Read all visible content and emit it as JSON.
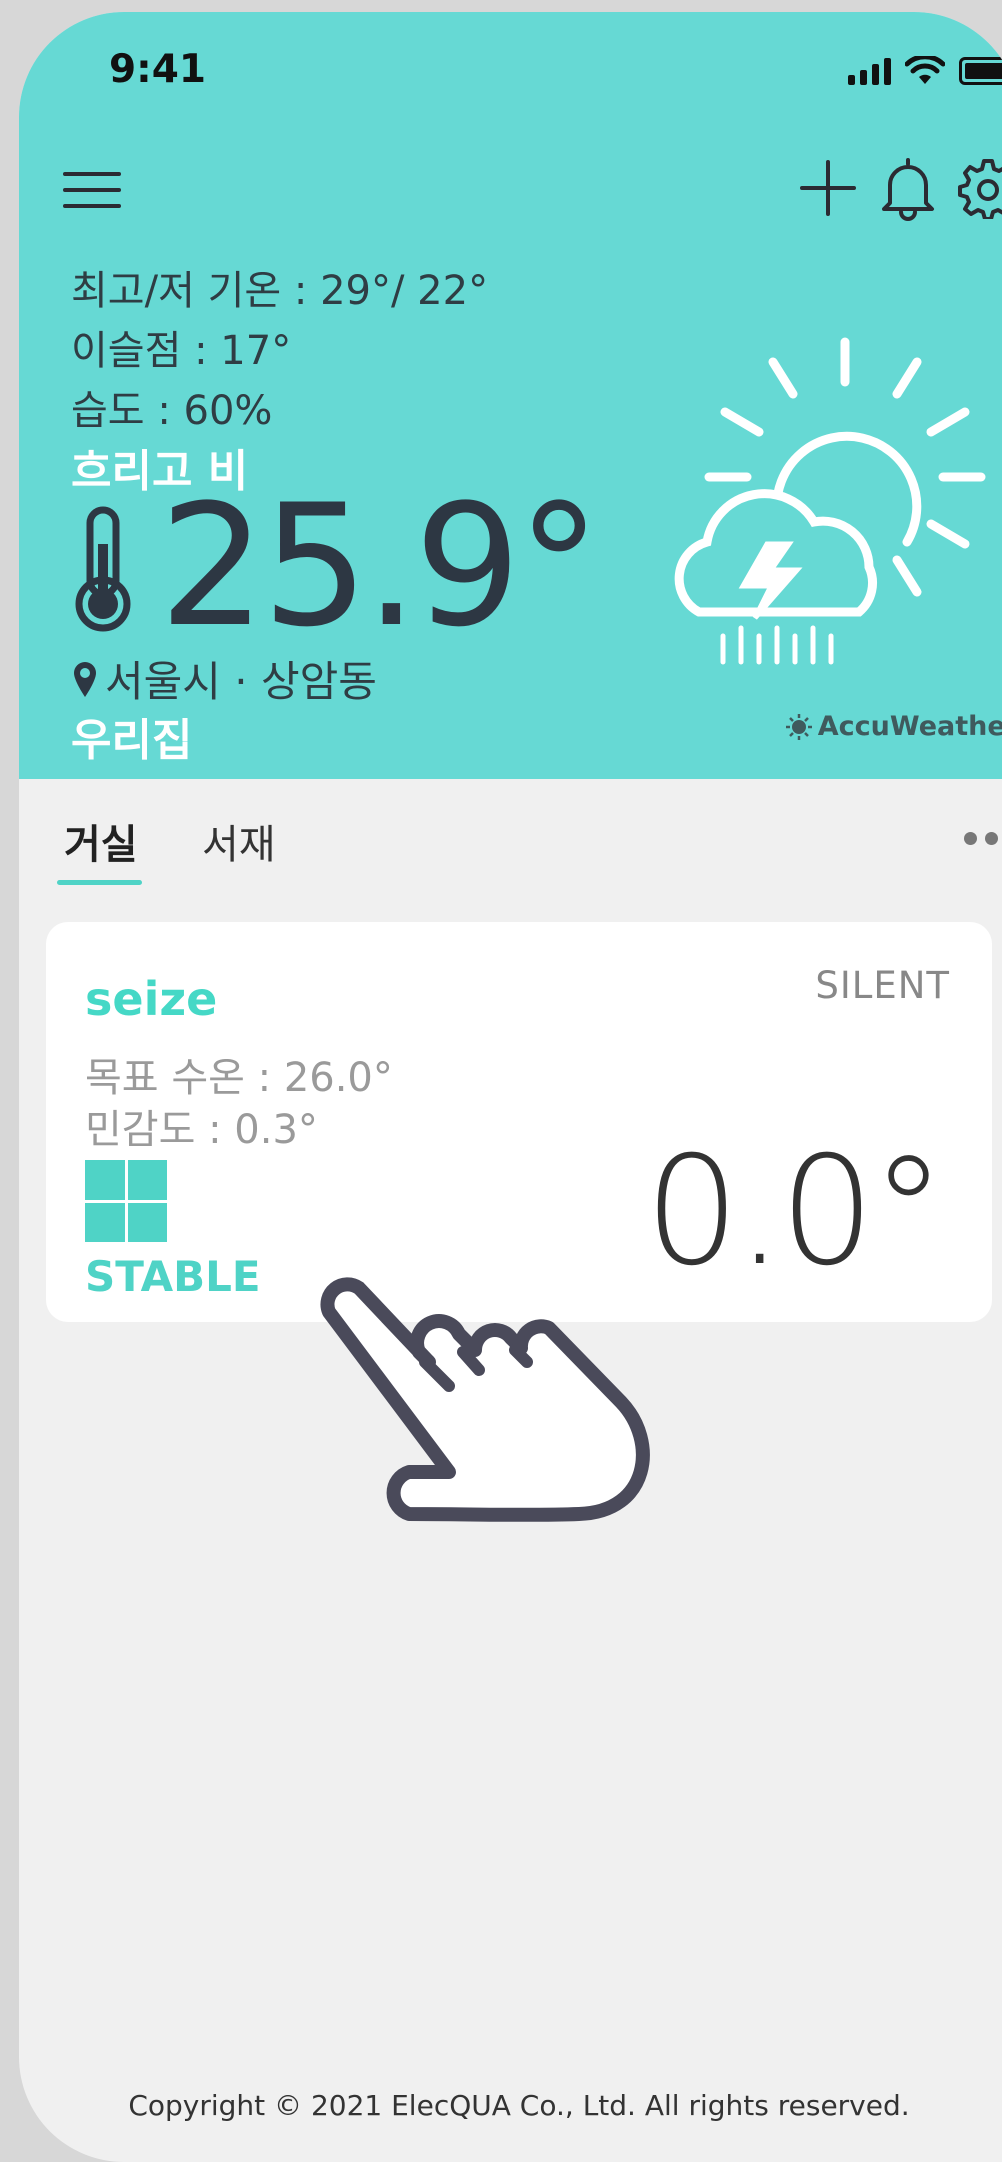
{
  "status_bar": {
    "time": "9:41"
  },
  "weather": {
    "high_low": "최고/저 기온 : 29°/ 22°",
    "dew_point": "이슬점 : 17°",
    "humidity": "습도 : 60%",
    "condition": "흐리고 비",
    "temperature": "25.9°",
    "location": "서울시 · 상암동",
    "home_name": "우리집",
    "provider": "AccuWeather"
  },
  "icons": {
    "menu": "menu-icon",
    "add": "plus-icon",
    "notifications": "bell-icon",
    "settings": "gear-icon",
    "weather": "partly-cloudy-thunder-rain-icon",
    "thermometer": "thermometer-icon",
    "location": "map-pin-icon",
    "more": "more-horizontal-icon",
    "gesture": "tap-hand-icon"
  },
  "tabs": [
    {
      "label": "거실",
      "active": true
    },
    {
      "label": "서재",
      "active": false
    }
  ],
  "device": {
    "name": "seize",
    "mode": "SILENT",
    "target_temp": "목표 수온 : 26.0°",
    "sensitivity": "민감도 : 0.3°",
    "state": "STABLE",
    "current_temp": "0.0°"
  },
  "footer": {
    "copyright": "Copyright © 2021 ElecQUA Co., Ltd. All rights reserved."
  },
  "colors": {
    "accent": "#66d9d4",
    "teal": "#4fd3c6",
    "background": "#f0f0f0"
  }
}
